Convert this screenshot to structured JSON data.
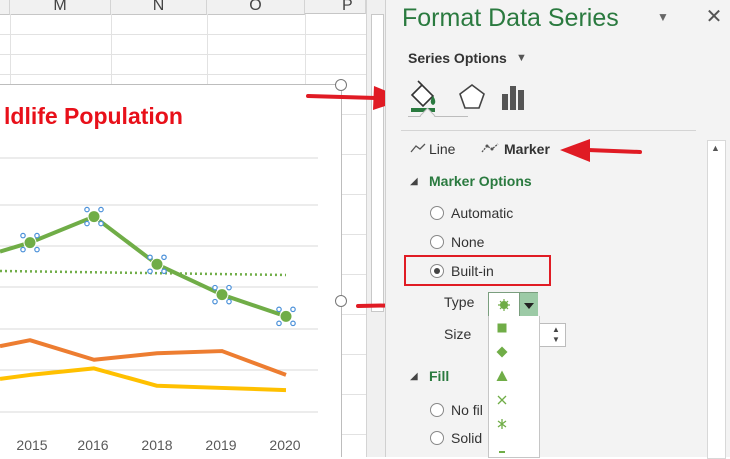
{
  "sheet": {
    "column_headers": [
      "M",
      "N",
      "O",
      "P"
    ]
  },
  "chart": {
    "title": "ldlife Population",
    "x_tick_labels": [
      "2015",
      "2016",
      "2018",
      "2019",
      "2020"
    ]
  },
  "chart_data": {
    "type": "line",
    "title": "ldlife Population",
    "categories": [
      "2015",
      "2016",
      "2018",
      "2019",
      "2020"
    ],
    "series": [
      {
        "color": "#70ad47",
        "values": [
          56,
          68,
          46,
          32,
          22
        ],
        "markers": true
      },
      {
        "color": "#ed7d31",
        "values": [
          11,
          2,
          5,
          6,
          -5
        ]
      },
      {
        "color": "#ffc000",
        "values": [
          -5,
          -2,
          -10,
          -11,
          -12
        ]
      },
      {
        "color": "#70ad47",
        "style": "dotted",
        "values": [
          42,
          42,
          42,
          42,
          42
        ]
      }
    ],
    "grid": true,
    "legend": "none"
  },
  "pane": {
    "title": "Format Data Series",
    "close_symbol": "✕",
    "dropdown_symbol": "▼",
    "series_options_label": "Series Options",
    "tabs": [
      {
        "name": "fill-line-icon",
        "active": true
      },
      {
        "name": "effects-pentagon-icon"
      },
      {
        "name": "series-options-bars-icon"
      }
    ],
    "subtabs": {
      "line": "Line",
      "marker": "Marker"
    },
    "marker_options": {
      "title": "Marker Options",
      "radios": [
        {
          "label": "Automatic",
          "checked": false
        },
        {
          "label": "None",
          "checked": false
        },
        {
          "label": "Built-in",
          "checked": true
        }
      ],
      "type_label": "Type",
      "size_label": "Size",
      "type_list": [
        "square",
        "diamond",
        "triangle",
        "x",
        "asterisk",
        "dash"
      ]
    },
    "fill": {
      "title": "Fill",
      "radios": [
        {
          "label": "No fil",
          "checked": false
        },
        {
          "label": "Solid",
          "checked": false
        }
      ]
    },
    "accent_color": "#2a7a3f",
    "highlight_color": "#e01b24"
  }
}
